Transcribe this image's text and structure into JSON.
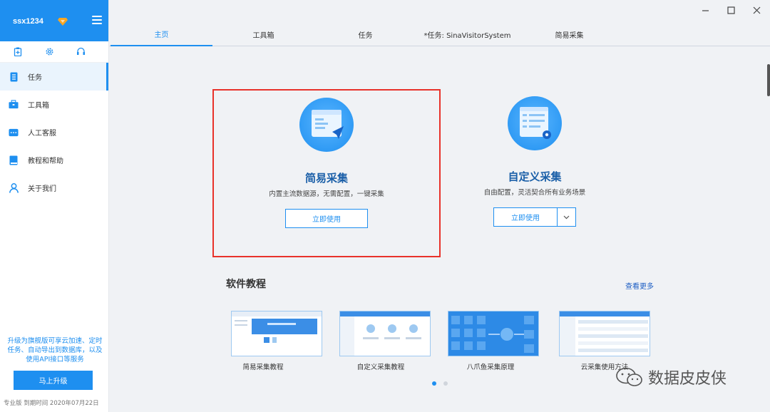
{
  "sidebar": {
    "username": "ssx1234",
    "nav": [
      {
        "label": "任务",
        "icon": "task-icon",
        "active": true
      },
      {
        "label": "工具箱",
        "icon": "toolbox-icon",
        "active": false
      },
      {
        "label": "人工客服",
        "icon": "chat-icon",
        "active": false
      },
      {
        "label": "教程和帮助",
        "icon": "book-icon",
        "active": false
      },
      {
        "label": "关于我们",
        "icon": "user-icon",
        "active": false
      }
    ],
    "upgrade_text": "升级为旗舰版可享云加速、定时任务、自动导出到数据库，以及使用API接口等服务",
    "upgrade_button": "马上升级",
    "expire_text": "专业版  到期时间 2020年07月22日"
  },
  "tabs": [
    {
      "label": "主页",
      "active": true
    },
    {
      "label": "工具箱",
      "active": false
    },
    {
      "label": "任务",
      "active": false
    },
    {
      "label": "*任务: SinaVisitorSystem",
      "active": false
    },
    {
      "label": "简易采集",
      "active": false
    }
  ],
  "cards": [
    {
      "title": "简易采集",
      "desc": "内置主流数据源，无需配置，一键采集",
      "button": "立即使用",
      "highlighted": true
    },
    {
      "title": "自定义采集",
      "desc": "自由配置，灵活契合所有业务场景",
      "button": "立即使用",
      "highlighted": false
    }
  ],
  "tutorials": {
    "title": "软件教程",
    "see_more": "查看更多",
    "items": [
      {
        "label": "简易采集教程"
      },
      {
        "label": "自定义采集教程"
      },
      {
        "label": "八爪鱼采集原理"
      },
      {
        "label": "云采集使用方法"
      }
    ]
  },
  "watermark": "数据皮皮侠",
  "colors": {
    "accent": "#1e8ff0",
    "highlight_border": "#e8322a",
    "title_blue": "#1a5fa8"
  }
}
